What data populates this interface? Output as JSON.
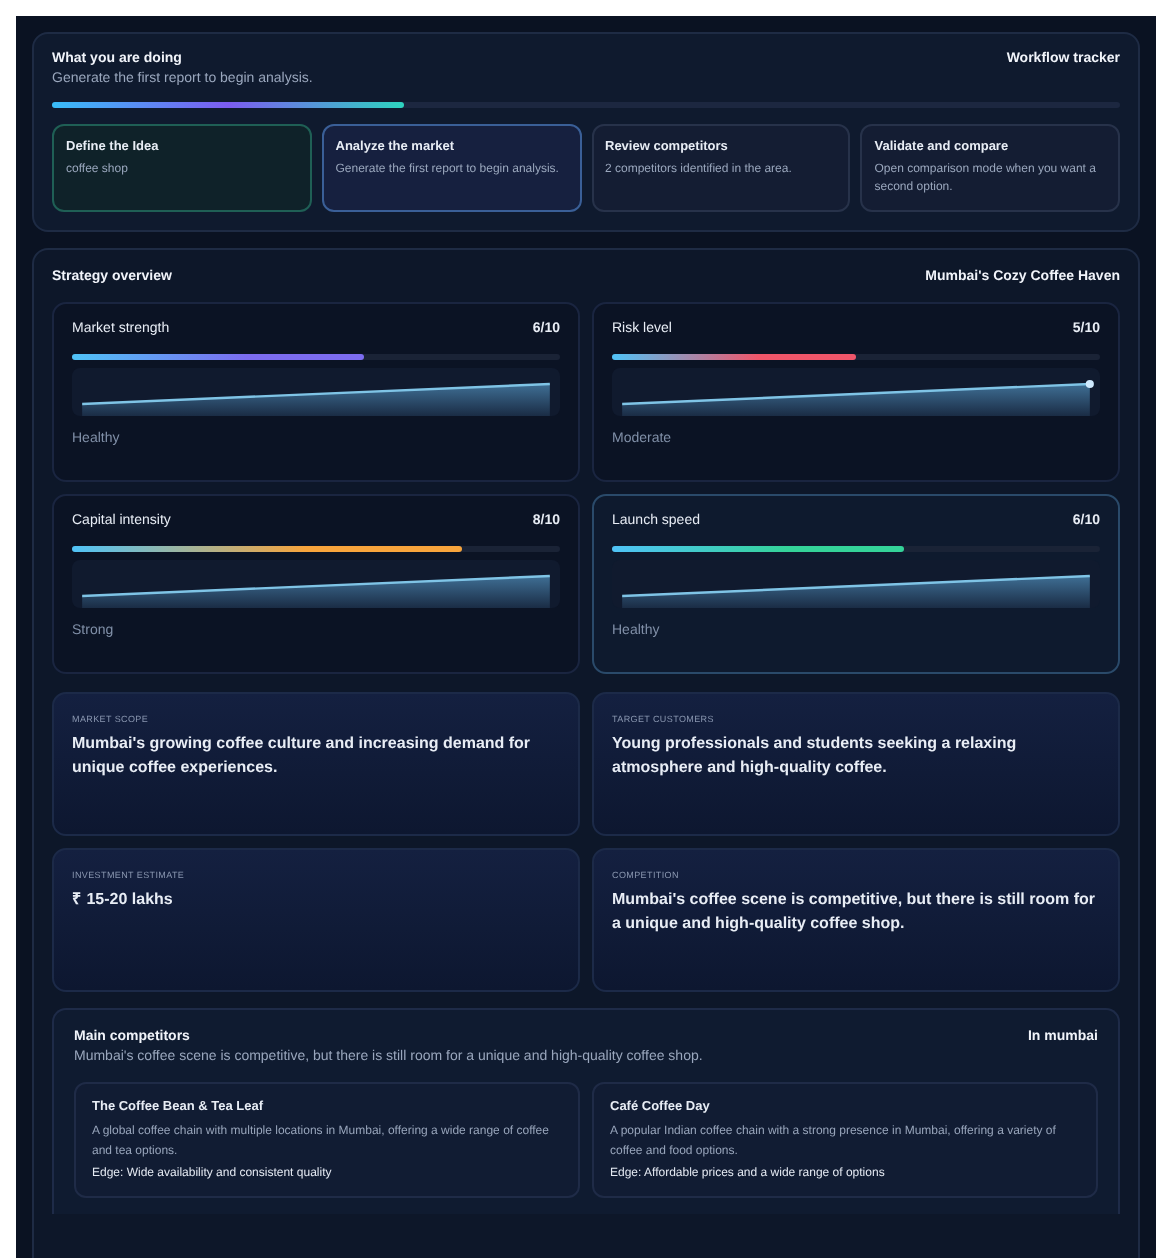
{
  "tracker": {
    "title": "What you are doing",
    "subtitle": "Generate the first report to begin analysis.",
    "tag": "Workflow tracker",
    "level": 0.33,
    "steps": [
      {
        "title": "Define the Idea",
        "text": "coffee shop",
        "done": true,
        "selected": false
      },
      {
        "title": "Analyze the market",
        "text": "Generate the first report to begin analysis.",
        "done": false,
        "selected": true
      },
      {
        "title": "Review competitors",
        "text": "2 competitors identified in the area.",
        "done": false,
        "selected": false
      },
      {
        "title": "Validate and compare",
        "text": "Open comparison mode when you want a second option.",
        "done": false,
        "selected": false
      }
    ]
  },
  "overview": {
    "title": "Strategy overview",
    "tag": "Mumbai's Cozy Coffee Haven",
    "metrics": [
      {
        "name": "Market strength",
        "score": "6/10",
        "level": 0.6,
        "color": "#7c6cf0",
        "status": "Healthy",
        "end_dot": false,
        "selected": false
      },
      {
        "name": "Risk level",
        "score": "5/10",
        "level": 0.5,
        "color": "#f0566a",
        "status": "Moderate",
        "end_dot": true,
        "selected": false
      },
      {
        "name": "Capital intensity",
        "score": "8/10",
        "level": 0.8,
        "color": "#f7a43c",
        "status": "Strong",
        "end_dot": false,
        "selected": false
      },
      {
        "name": "Launch speed",
        "score": "6/10",
        "level": 0.6,
        "color": "#34d399",
        "status": "Healthy",
        "end_dot": false,
        "selected": true
      }
    ],
    "facts": [
      {
        "label": "MARKET SCOPE",
        "text": "Mumbai's growing coffee culture and increasing demand for unique coffee experiences."
      },
      {
        "label": "TARGET CUSTOMERS",
        "text": "Young professionals and students seeking a relaxing atmosphere and high-quality coffee."
      },
      {
        "label": "INVESTMENT ESTIMATE",
        "text": "₹ 15-20 lakhs"
      },
      {
        "label": "COMPETITION",
        "text": "Mumbai's coffee scene is competitive, but there is still room for a unique and high-quality coffee shop."
      }
    ],
    "competitors": {
      "title": "Main competitors",
      "subtitle": "Mumbai's coffee scene is competitive, but there is still room for a unique and high-quality coffee shop.",
      "tag": "In mumbai",
      "items": [
        {
          "name": "The Coffee Bean & Tea Leaf",
          "text": "A global coffee chain with multiple locations in Mumbai, offering a wide range of coffee and tea options.",
          "edge": "Edge: Wide availability and consistent quality"
        },
        {
          "name": "Café Coffee Day",
          "text": "A popular Indian coffee chain with a strong presence in Mumbai, offering a variety of coffee and food options.",
          "edge": "Edge: Affordable prices and a wide range of options"
        }
      ]
    }
  }
}
